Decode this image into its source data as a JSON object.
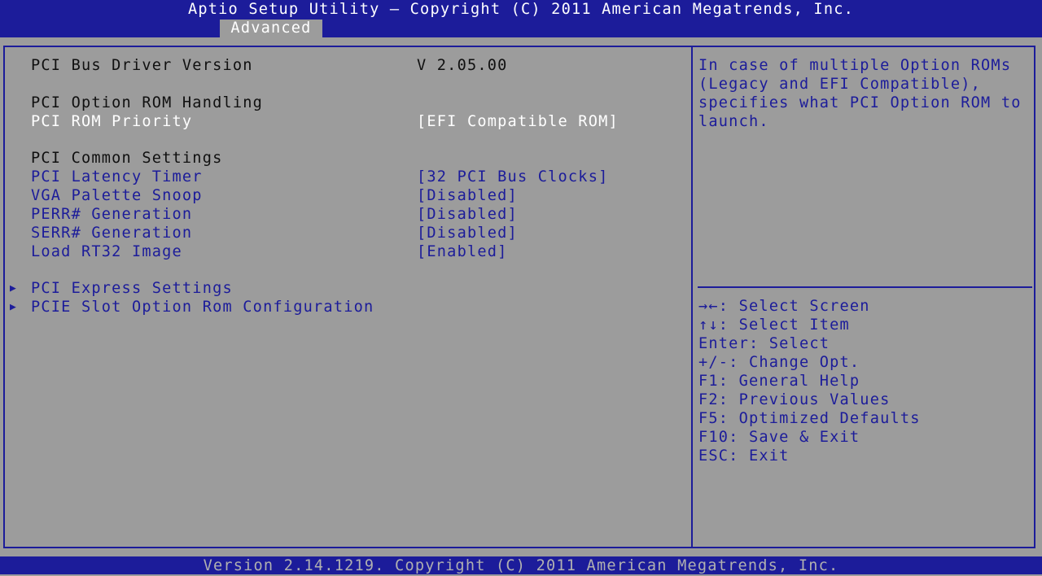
{
  "header": {
    "title": "Aptio Setup Utility – Copyright (C) 2011 American Megatrends, Inc.",
    "active_tab": "Advanced"
  },
  "settings": {
    "bus_driver_label": "PCI Bus Driver Version",
    "bus_driver_value": "V 2.05.00",
    "rom_handling_heading": "PCI Option ROM Handling",
    "rom_priority_label": "PCI ROM Priority",
    "rom_priority_value": "[EFI Compatible ROM]",
    "common_heading": "PCI Common Settings",
    "latency_label": "PCI Latency Timer",
    "latency_value": "[32 PCI Bus Clocks]",
    "vga_label": "VGA Palette Snoop",
    "vga_value": "[Disabled]",
    "perr_label": "PERR# Generation",
    "perr_value": "[Disabled]",
    "serr_label": "SERR# Generation",
    "serr_value": "[Disabled]",
    "rt32_label": "Load RT32 Image",
    "rt32_value": "[Enabled]",
    "submenu_arrow": "▶",
    "express_label": "PCI Express Settings",
    "slot_label": "PCIE Slot Option Rom Configuration"
  },
  "help": {
    "text": "In case of multiple Option ROMs (Legacy and EFI Compatible), specifies what PCI Option ROM to launch."
  },
  "keys": [
    "→←: Select Screen",
    "↑↓: Select Item",
    "Enter: Select",
    "+/-: Change Opt.",
    "F1: General Help",
    "F2: Previous Values",
    "F5: Optimized Defaults",
    "F10: Save & Exit",
    "ESC: Exit"
  ],
  "footer": {
    "text": "Version 2.14.1219. Copyright (C) 2011 American Megatrends, Inc."
  },
  "colors": {
    "bar_blue": "#1c1c9a",
    "panel_gray": "#9c9c9c",
    "text_white": "#ffffff",
    "text_dark": "#101010"
  }
}
